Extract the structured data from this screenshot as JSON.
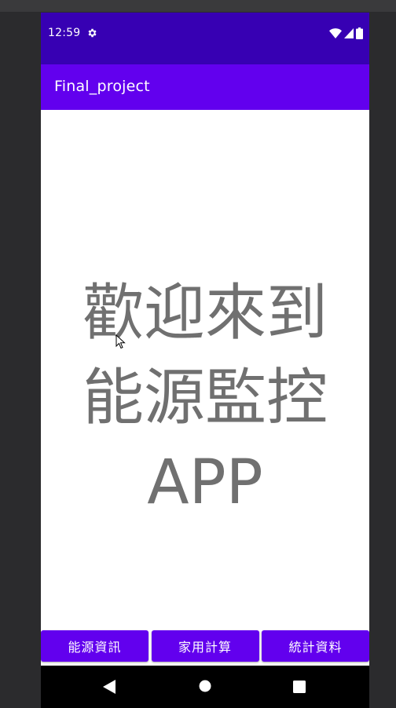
{
  "status_bar": {
    "time": "12:59",
    "background": "#3700b3",
    "icons": [
      "gear-icon",
      "wifi-icon",
      "cellular-signal-icon",
      "battery-icon"
    ]
  },
  "app_bar": {
    "title": "Final_project",
    "background": "#6200ee"
  },
  "main": {
    "welcome_lines": [
      "歡迎來到",
      "能源監控",
      "APP"
    ],
    "text_color": "#707070"
  },
  "bottom_buttons": [
    {
      "label": "能源資訊"
    },
    {
      "label": "家用計算"
    },
    {
      "label": "統計資料"
    }
  ],
  "system_nav": {
    "icons": [
      "back-icon",
      "home-icon",
      "recents-icon"
    ]
  },
  "accent_color": "#6200ee"
}
